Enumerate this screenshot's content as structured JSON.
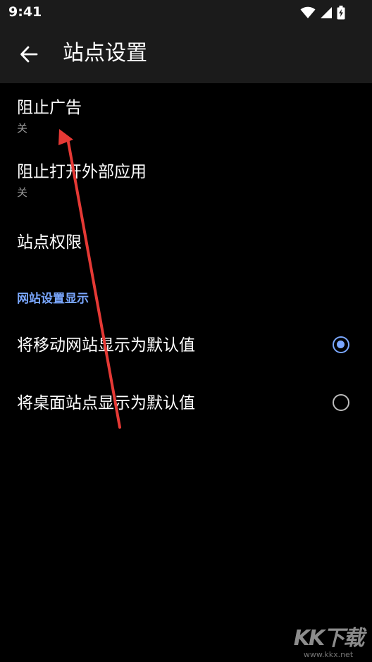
{
  "status_bar": {
    "time": "9:41",
    "icons": [
      "wifi-icon",
      "cellular-signal-icon",
      "battery-charging-icon"
    ]
  },
  "app_bar": {
    "back_icon": "arrow-back-icon",
    "title": "站点设置"
  },
  "settings": [
    {
      "title": "阻止广告",
      "summary": "关"
    },
    {
      "title": "阻止打开外部应用",
      "summary": "关"
    },
    {
      "title": "站点权限",
      "summary": ""
    }
  ],
  "section": {
    "header": "网站设置显示"
  },
  "display_options": [
    {
      "label": "将移动网站显示为默认值",
      "checked": true
    },
    {
      "label": "将桌面站点显示为默认值",
      "checked": false
    }
  ],
  "watermark": {
    "logo": "KK下载",
    "url": "www.kkx.net"
  },
  "colors": {
    "background": "#000000",
    "app_bar": "#1b1b1b",
    "accent": "#7aa7ff",
    "annotation_arrow": "#e53935"
  }
}
